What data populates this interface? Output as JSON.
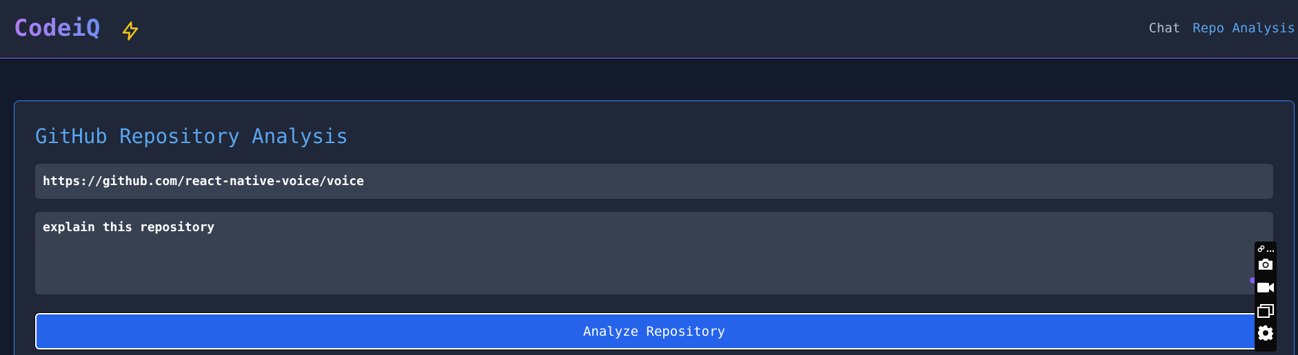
{
  "app": {
    "brand": "CodeiQ",
    "brand_icon": "lightning-bolt-icon",
    "accent_color": "#8b5cf6"
  },
  "nav": {
    "links": [
      {
        "label": "Chat",
        "active": false
      },
      {
        "label": "Repo Analysis",
        "active": true
      }
    ]
  },
  "analysis": {
    "title": "GitHub Repository Analysis",
    "repo_url_value": "https://github.com/react-native-voice/voice",
    "question_value": "explain this repository",
    "button_label": "Analyze Repository",
    "button_color": "#2563eb"
  },
  "toolbar": {
    "icons": [
      "link-icon",
      "more-icon",
      "camera-icon",
      "video-camera-icon",
      "windows-icon",
      "settings-icon"
    ]
  }
}
